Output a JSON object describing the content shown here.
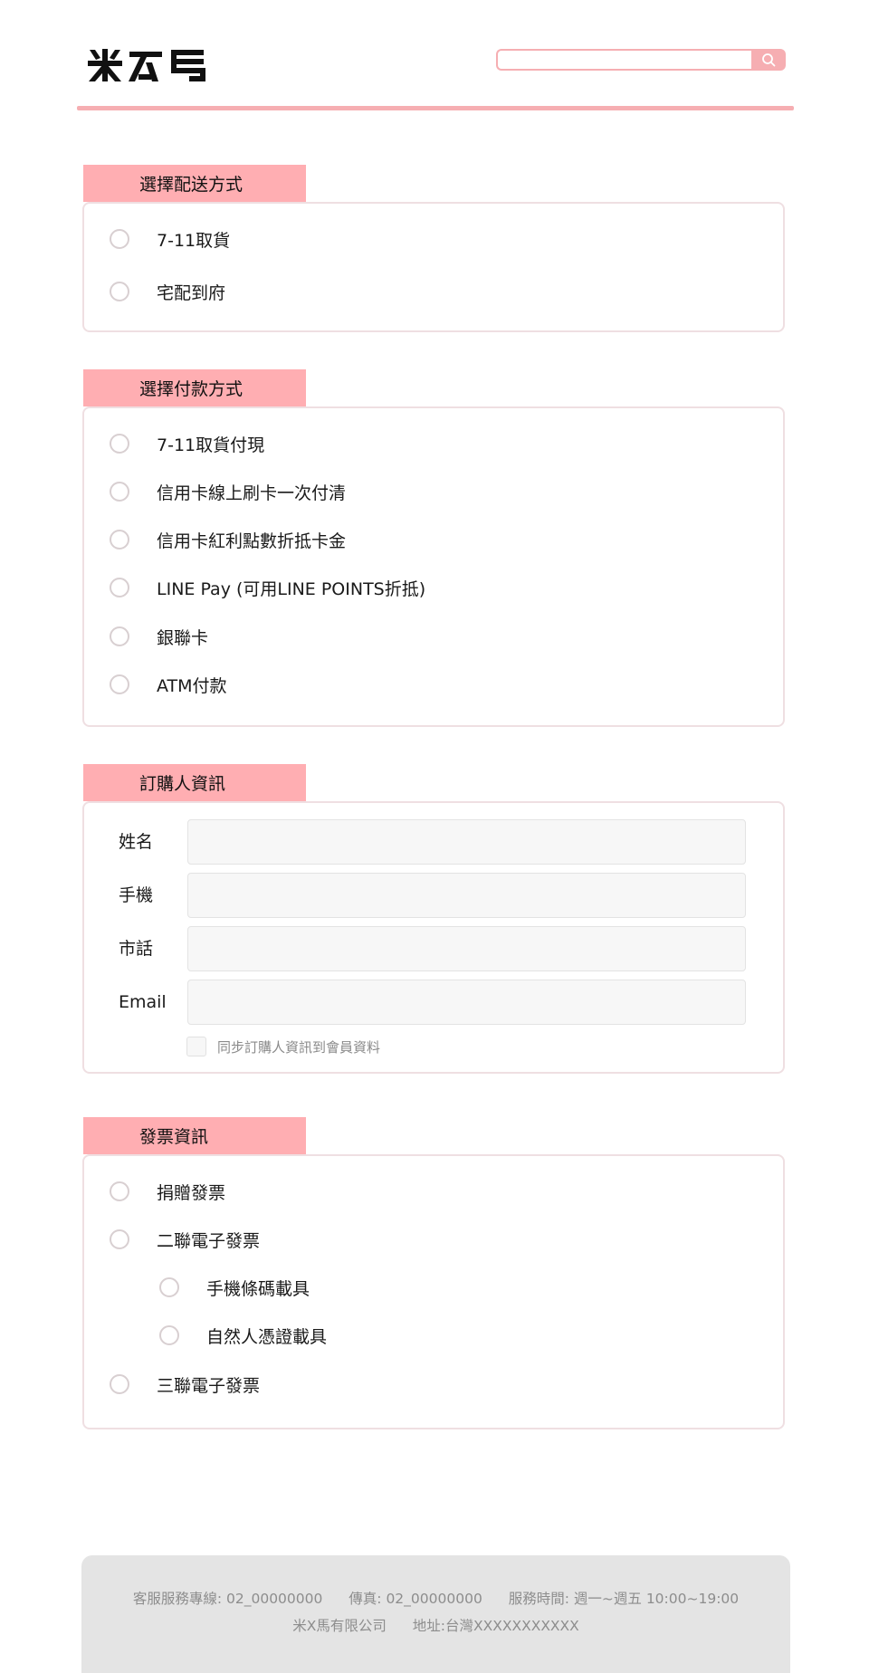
{
  "header": {
    "logo_text": "米X馬",
    "search": {
      "placeholder": "",
      "value": ""
    },
    "accent_color": "#f6aeb2"
  },
  "shipping": {
    "title": "選擇配送方式",
    "options": [
      "7-11取貨",
      "宅配到府"
    ]
  },
  "payment": {
    "title": "選擇付款方式",
    "options": [
      "7-11取貨付現",
      "信用卡線上刷卡一次付清",
      "信用卡紅利點數折抵卡金",
      "LINE Pay (可用LINE POINTS折抵)",
      "銀聯卡",
      "ATM付款"
    ]
  },
  "buyer": {
    "title": "訂購人資訊",
    "fields": [
      {
        "label": "姓名",
        "value": ""
      },
      {
        "label": "手機",
        "value": ""
      },
      {
        "label": "市話",
        "value": ""
      },
      {
        "label": "Email",
        "value": ""
      }
    ],
    "sync_label": "同步訂購人資訊到會員資料"
  },
  "invoice": {
    "title": "發票資訊",
    "options": [
      "捐贈發票",
      "二聯電子發票",
      "三聯電子發票"
    ],
    "carrier_options": [
      "手機條碼載具",
      "自然人憑證載具"
    ]
  },
  "footer": {
    "phone": "客服服務專線: 02_00000000",
    "fax": "傳真: 02_00000000",
    "hours": "服務時間: 週一~週五 10:00~19:00",
    "company": "米X馬有限公司",
    "address": "地址:台灣XXXXXXXXXXX"
  }
}
